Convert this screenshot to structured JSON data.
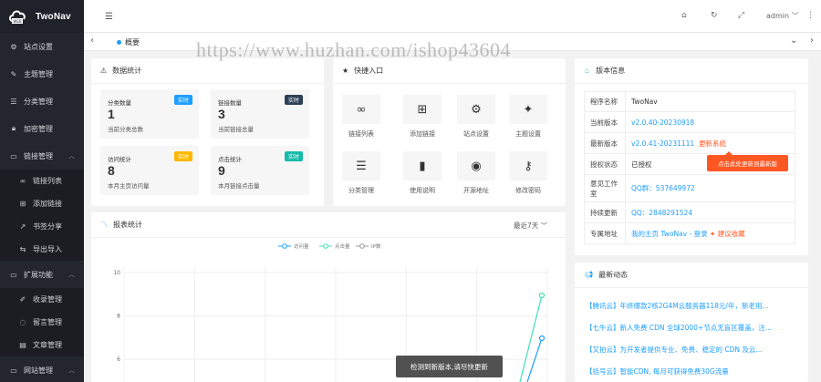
{
  "app": {
    "name": "TwoNav",
    "user": "admin"
  },
  "watermark": "https://www.huzhan.com/ishop43604",
  "sidebar": {
    "items": [
      {
        "label": "站点设置",
        "icon": "gear-icon"
      },
      {
        "label": "主题管理",
        "icon": "brush-icon"
      },
      {
        "label": "分类管理",
        "icon": "list-icon"
      },
      {
        "label": "加密管理",
        "icon": "lock-icon"
      },
      {
        "label": "链接管理",
        "icon": "folder-icon",
        "expanded": true
      },
      {
        "label": "扩展功能",
        "icon": "folder-icon",
        "expanded": true
      },
      {
        "label": "网站管理",
        "icon": "folder-icon",
        "expanded": true
      }
    ],
    "link_sub": [
      {
        "label": "链接列表",
        "icon": "link-icon"
      },
      {
        "label": "添加链接",
        "icon": "plus-icon"
      },
      {
        "label": "书签分享",
        "icon": "share-icon"
      },
      {
        "label": "导出导入",
        "icon": "transfer-icon"
      }
    ],
    "ext_sub": [
      {
        "label": "收录管理",
        "icon": "pen-icon"
      },
      {
        "label": "留言管理",
        "icon": "message-icon"
      },
      {
        "label": "文章管理",
        "icon": "article-icon"
      }
    ]
  },
  "tabs": {
    "home": "概要"
  },
  "stats_card": {
    "title": "数据统计",
    "items": [
      {
        "label": "分类数量",
        "value": "1",
        "desc": "当前分类总数",
        "badge": "实时",
        "badge_color": "#1e9fff"
      },
      {
        "label": "链接数量",
        "value": "3",
        "desc": "当前链接总量",
        "badge": "实时",
        "badge_color": "#2f4056"
      },
      {
        "label": "访问统计",
        "value": "8",
        "desc": "本月主页访问量",
        "badge": "实时",
        "badge_color": "#ffb800"
      },
      {
        "label": "点击统计",
        "value": "9",
        "desc": "本月链接点击量",
        "badge": "实时",
        "badge_color": "#16baaa"
      }
    ]
  },
  "quick_card": {
    "title": "快捷入口",
    "items": [
      {
        "label": "链接列表",
        "icon": "link-icon"
      },
      {
        "label": "添加链接",
        "icon": "plus-square-icon"
      },
      {
        "label": "站点设置",
        "icon": "gear-icon"
      },
      {
        "label": "主题设置",
        "icon": "magic-wand-icon"
      },
      {
        "label": "分类管理",
        "icon": "list-icon"
      },
      {
        "label": "使用说明",
        "icon": "book-icon"
      },
      {
        "label": "开源地址",
        "icon": "github-icon"
      },
      {
        "label": "修改密码",
        "icon": "key-icon"
      }
    ]
  },
  "version_card": {
    "title": "版本信息",
    "rows": [
      {
        "key": "程序名称",
        "value": "TwoNav"
      },
      {
        "key": "当前版本",
        "value": "v2.0.40-20230918"
      },
      {
        "key": "最新版本",
        "value": "v2.0.41-20231111",
        "extra": "更新系统"
      },
      {
        "key": "授权状态",
        "value": "已授权"
      },
      {
        "key": "QQ群",
        "value": "QQ群：537649972"
      },
      {
        "key": "持续更新",
        "value": "QQ：2848291524"
      },
      {
        "key": "专属地址",
        "value": "我的主页   TwoNav - 登录",
        "extra": "✦ 建议收藏"
      }
    ],
    "qq_key_lines": [
      "意见工作",
      "室"
    ],
    "popover": "点击此处更新到最新版"
  },
  "chart_card": {
    "title": "报表统计",
    "range": "最近7天",
    "chart_data": {
      "type": "line",
      "legend": [
        "访问量",
        "点击量",
        "IP数"
      ],
      "series_colors": [
        "#1e9fff",
        "#3de0b6",
        "#999999"
      ],
      "y_ticks": [
        10,
        8,
        6
      ],
      "ylim": [
        6,
        10
      ]
    }
  },
  "news_card": {
    "title": "最新动态",
    "items": [
      "【腾讯云】年终爆款2核2G4M云服务器118元/年，新老用...",
      "【七牛云】新人免费 CDN 全球2000+节点无盲区覆盖，注...",
      "【又拍云】为开发者提供专业、免费、稳定的 CDN 及云...",
      "【括号云】智能CDN, 每月可获得免费30G流量"
    ]
  },
  "toast": "检测到新版本,请尽快更新"
}
